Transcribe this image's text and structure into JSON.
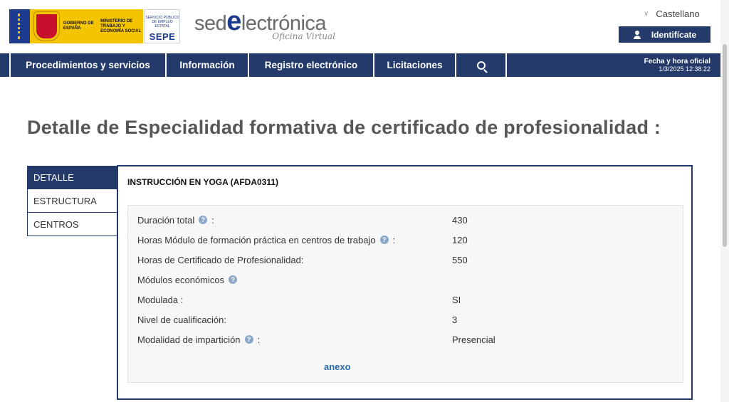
{
  "header": {
    "gov_line1": "GOBIERNO DE ESPAÑA",
    "gov_line2": "MINISTERIO DE TRABAJO Y ECONOMÍA SOCIAL",
    "sepe_small": "SERVICIO PÚBLICO DE EMPLEO ESTATAL",
    "sepe_big": "SEPE",
    "sede_pre": "sed",
    "sede_e": "e",
    "sede_post": "lectrónica",
    "sede_sub": "Oficina Virtual",
    "language": "Castellano",
    "login_label": "Identifícate"
  },
  "nav": {
    "items": [
      "Procedimientos y servicios",
      "Información",
      "Registro electrónico",
      "Licitaciones"
    ],
    "date_label": "Fecha y hora oficial",
    "date_value": "1/3/2025 12:38:22"
  },
  "page": {
    "title": "Detalle de Especialidad formativa de certificado de profesionalidad :"
  },
  "tabs": [
    "DETALLE",
    "ESTRUCTURA",
    "CENTROS"
  ],
  "panel": {
    "heading": "INSTRUCCIÓN EN YOGA (AFDA0311)",
    "rows": [
      {
        "label": "Duración total",
        "help": true,
        "suffix": ":",
        "value": "430"
      },
      {
        "label": "Horas Módulo de formación práctica en centros de trabajo",
        "help": true,
        "suffix": ":",
        "value": "120"
      },
      {
        "label": "Horas de Certificado de Profesionalidad:",
        "help": false,
        "suffix": "",
        "value": "550"
      },
      {
        "label": "Módulos económicos",
        "help": true,
        "suffix": "",
        "value": ""
      },
      {
        "label": "Modulada :",
        "help": false,
        "suffix": "",
        "value": "SI"
      },
      {
        "label": "Nivel de cualificación:",
        "help": false,
        "suffix": "",
        "value": "3"
      },
      {
        "label": "Modalidad de impartición",
        "help": true,
        "suffix": ":",
        "value": "Presencial"
      }
    ],
    "annex_link": "anexo"
  },
  "help_glyph": "?",
  "colors": {
    "brand_navy": "#233a6b",
    "gov_yellow": "#f4c400",
    "link_blue": "#2a6cb0"
  }
}
